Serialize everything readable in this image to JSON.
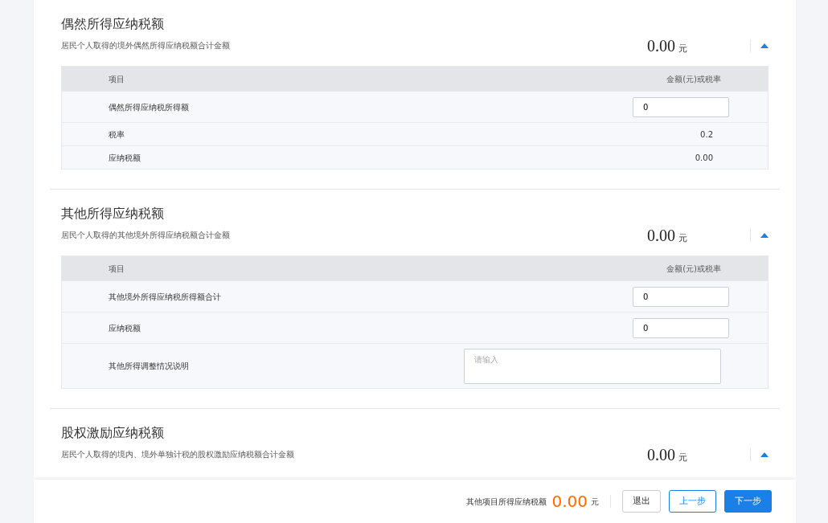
{
  "sections": [
    {
      "title": "偶然所得应纳税额",
      "subtitle": "居民个人取得的境外偶然所得应纳税额合计金额",
      "amount": "0.00",
      "unit": "元",
      "expanded": true,
      "table": {
        "columns": [
          "项目",
          "金额(元)或税率"
        ],
        "rows": [
          {
            "label": "偶然所得应纳税所得额",
            "kind": "input",
            "value": "0"
          },
          {
            "label": "税率",
            "kind": "text",
            "value": "0.2"
          },
          {
            "label": "应纳税额",
            "kind": "text",
            "value": "0.00"
          }
        ]
      }
    },
    {
      "title": "其他所得应纳税额",
      "subtitle": "居民个人取得的其他境外所得应纳税额合计金额",
      "amount": "0.00",
      "unit": "元",
      "expanded": true,
      "table": {
        "columns": [
          "项目",
          "金额(元)或税率"
        ],
        "rows": [
          {
            "label": "其他境外所得应纳税所得额合计",
            "kind": "input",
            "value": "0"
          },
          {
            "label": "应纳税额",
            "kind": "input",
            "value": "0"
          },
          {
            "label": "其他所得调整情况说明",
            "kind": "textarea",
            "placeholder": "请输入"
          }
        ]
      }
    },
    {
      "title": "股权激励应纳税额",
      "subtitle": "居民个人取得的境内、境外单独计税的股权激励应纳税额合计金额",
      "amount": "0.00",
      "unit": "元",
      "expanded": true
    }
  ],
  "footer": {
    "label": "其他项目所得应纳税额",
    "amount": "0.00",
    "unit": "元",
    "buttons": [
      {
        "label": "退出",
        "kind": "plain"
      },
      {
        "label": "上一步",
        "kind": "outline"
      },
      {
        "label": "下一步",
        "kind": "primary"
      }
    ]
  }
}
